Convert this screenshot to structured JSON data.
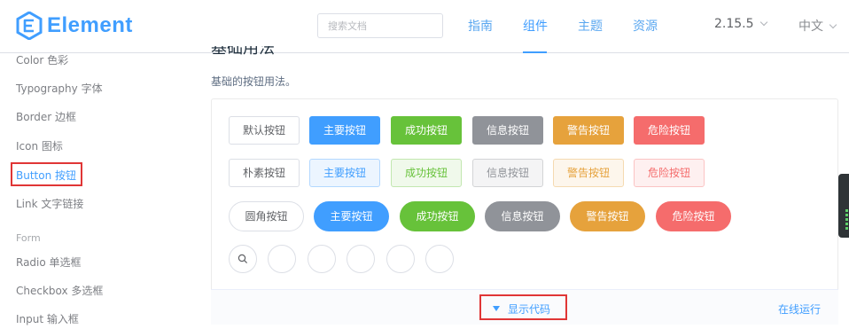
{
  "header": {
    "logo_text": "Element",
    "search_placeholder": "搜索文档",
    "nav": [
      "指南",
      "组件",
      "主题",
      "资源"
    ],
    "active_nav": "组件",
    "version": "2.15.5",
    "language": "中文"
  },
  "sidebar": {
    "items": [
      {
        "label": "Color 色彩"
      },
      {
        "label": "Typography 字体"
      },
      {
        "label": "Border 边框"
      },
      {
        "label": "Icon 图标"
      },
      {
        "label": "Button 按钮"
      },
      {
        "label": "Link 文字链接"
      }
    ],
    "group": "Form",
    "form_items": [
      {
        "label": "Radio 单选框"
      },
      {
        "label": "Checkbox 多选框"
      },
      {
        "label": "Input 输入框"
      }
    ],
    "active_item": "Button 按钮"
  },
  "content": {
    "section_title": "基础用法",
    "description": "基础的按钮用法。",
    "rows": {
      "default": [
        "默认按钮",
        "主要按钮",
        "成功按钮",
        "信息按钮",
        "警告按钮",
        "危险按钮"
      ],
      "plain": [
        "朴素按钮",
        "主要按钮",
        "成功按钮",
        "信息按钮",
        "警告按钮",
        "危险按钮"
      ],
      "round": [
        "圆角按钮",
        "主要按钮",
        "成功按钮",
        "信息按钮",
        "警告按钮",
        "危险按钮"
      ]
    },
    "icon_buttons": [
      "search-icon",
      "edit-icon",
      "check-icon",
      "message-icon",
      "star-icon",
      "delete-icon"
    ],
    "show_code": "显示代码",
    "online_run": "在线运行"
  },
  "colors": {
    "primary": "#409eff",
    "success": "#67c23a",
    "info": "#909399",
    "warning": "#e6a23c",
    "danger": "#f56c6c",
    "highlight_box": "#e03636"
  }
}
